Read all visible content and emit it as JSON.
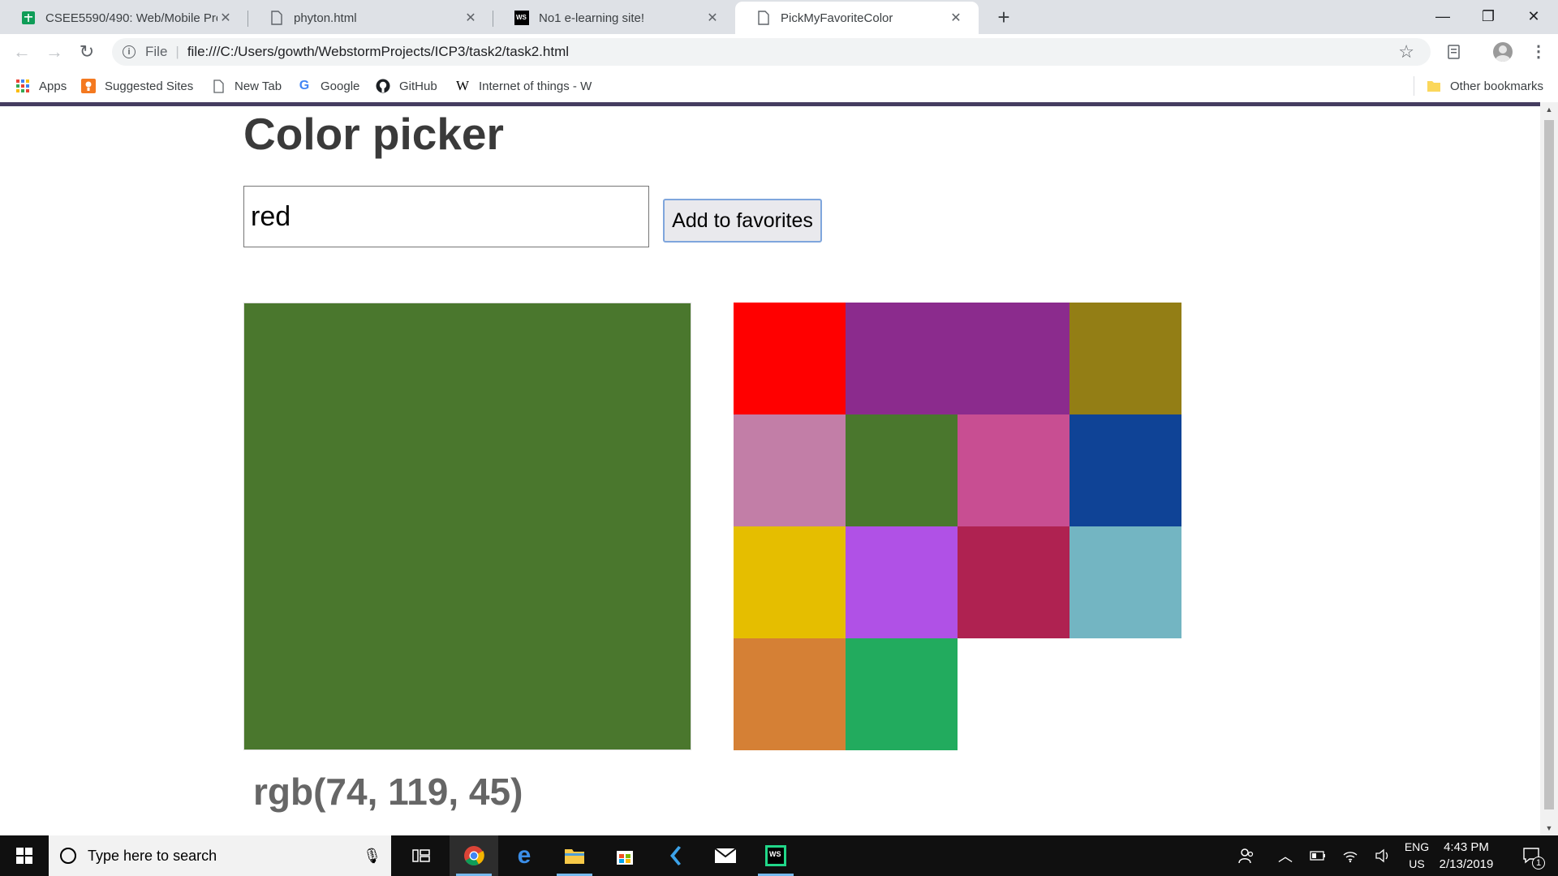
{
  "browser": {
    "tabs": [
      {
        "title": "CSEE5590/490: Web/Mobile Prog",
        "icon": "sheets-icon",
        "active": false
      },
      {
        "title": "phyton.html",
        "icon": "page-icon",
        "active": false
      },
      {
        "title": "No1 e-learning site!",
        "icon": "ws-icon",
        "active": false
      },
      {
        "title": "PickMyFavoriteColor",
        "icon": "page-icon",
        "active": true
      }
    ],
    "new_tab_symbol": "+",
    "window_controls": {
      "minimize": "—",
      "restore": "❐",
      "close": "✕"
    },
    "nav": {
      "back": "←",
      "forward": "→",
      "reload": "↻"
    },
    "address": {
      "scheme_label": "File",
      "url": "file:///C:/Users/gowth/WebstormProjects/ICP3/task2/task2.html"
    },
    "bookmarks": [
      {
        "label": "Apps",
        "icon": "apps-grid-icon"
      },
      {
        "label": "Suggested Sites",
        "icon": "suggested-sites-icon"
      },
      {
        "label": "New Tab",
        "icon": "page-icon"
      },
      {
        "label": "Google",
        "icon": "google-icon"
      },
      {
        "label": "GitHub",
        "icon": "github-icon"
      },
      {
        "label": "Internet of things - W",
        "icon": "wikipedia-icon"
      }
    ],
    "other_bookmarks": "Other bookmarks"
  },
  "page": {
    "title": "Color picker",
    "input_value": "red",
    "add_button_label": "Add to favorites",
    "preview_color": "#4a772d",
    "rgb_text": "rgb(74, 119, 45)",
    "favorites": [
      "#ff0000",
      "#8b2b8d",
      "#8b2b8d",
      "#937e15",
      "#c27ea7",
      "#4a772d",
      "#c84e92",
      "#0f4396",
      "#e5be00",
      "#b051e6",
      "#af2251",
      "#73b5c2",
      "#d58035",
      "#22ab5e"
    ]
  },
  "taskbar": {
    "search_placeholder": "Type here to search",
    "language": "ENG",
    "region": "US",
    "time": "4:43 PM",
    "date": "2/13/2019",
    "notification_count": "1"
  }
}
